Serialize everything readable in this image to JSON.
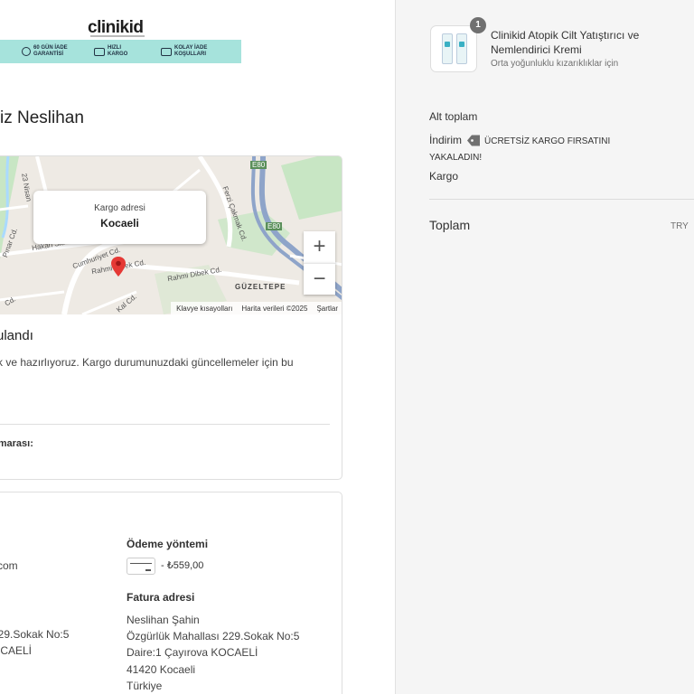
{
  "header": {
    "logo_text": "clinikid",
    "banner": [
      {
        "icon": "return-icon",
        "label": "60 GÜN İADE GARANTİSİ"
      },
      {
        "icon": "truck-icon",
        "label": "HIZLI KARGO"
      },
      {
        "icon": "truck-icon",
        "label": "KOLAY İADE KOŞULLARI"
      }
    ]
  },
  "thanks_title": "iz Neslihan",
  "map": {
    "bubble_label": "Kargo adresi",
    "bubble_city": "Kocaeli",
    "labels": [
      "E80",
      "E80",
      "23 Nisan",
      "Ferzi Çakmak Cd.",
      "Hakan Sk.",
      "Cumhuriyet Cd.",
      "Rahmi Dibek Cd.",
      "Rahmi Dibek Cd.",
      "Pınar Cd.",
      "Cd.",
      "Kal Cd.",
      "GÜZELTEPE"
    ],
    "footer": [
      "Klavye kısayolları",
      "Harita verileri ©2025",
      "Şartlar"
    ],
    "zoom_in": "+",
    "zoom_out": "−",
    "colors": {
      "road": "#ffffff",
      "highway": "#8ea4c9",
      "park": "#c8e6c4",
      "water": "#aadaff",
      "pin": "#e53935"
    }
  },
  "order_status": {
    "title": "rulandı",
    "text": "tik ve hazırlıyoruz. Kargo durumunuzdaki güncellemeler için bu\n.",
    "tracking_label": "umarası:"
  },
  "customer": {
    "email_fragment": "l.com",
    "address_lines": [
      "229.Sokak No:5",
      "OCAELİ"
    ]
  },
  "payment": {
    "heading": "Ödeme yöntemi",
    "amount": "- ₺559,00"
  },
  "billing": {
    "heading": "Fatura adresi",
    "lines": [
      "Neslihan Şahin",
      "Özgürlük Mahallası 229.Sokak No:5",
      "Daire:1 Çayırova KOCAELİ",
      "41420 Kocaeli",
      "Türkiye"
    ]
  },
  "summary": {
    "quantity": "1",
    "product_name": "Clinikid Atopik Cilt Yatıştırıcı ve Nemlendirici Kremi",
    "variant": "Orta yoğunluklu kızarıklıklar için",
    "subtotal_label": "Alt toplam",
    "discount_label": "İndirim",
    "discount_code": "ÜCRETSİZ KARGO FIRSATINI YAKALADIN!",
    "shipping_label": "Kargo",
    "total_label": "Toplam",
    "currency": "TRY"
  }
}
